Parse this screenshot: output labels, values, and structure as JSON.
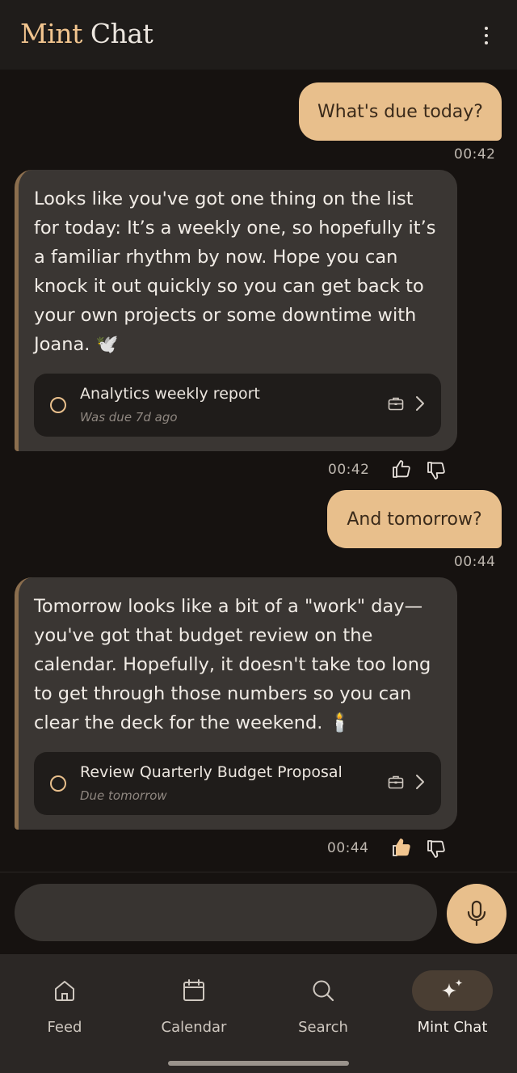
{
  "header": {
    "title_part1": "Mint",
    "title_part2": " Chat",
    "menu_icon": "more-vertical-icon"
  },
  "messages": [
    {
      "role": "user",
      "text": "What's due today?",
      "time": "00:42"
    },
    {
      "role": "assistant",
      "text": "Looks like you've got one thing on the list for today: It’s a weekly one, so hopefully it’s a familiar rhythm by now. Hope you can knock it out quickly so you can get back to your own projects or some downtime with Joana. 🕊️",
      "task": {
        "title": "Analytics weekly report",
        "subtitle": "Was due 7d ago"
      },
      "time": "00:42",
      "thumbs_up": false
    },
    {
      "role": "user",
      "text": "And tomorrow?",
      "time": "00:44"
    },
    {
      "role": "assistant",
      "text": "Tomorrow looks like a bit of a \"work\" day—you've got that budget review on the calendar. Hopefully, it doesn't take too long to get through those numbers so you can clear the deck for the weekend. 🕯️",
      "task": {
        "title": "Review Quarterly Budget Proposal",
        "subtitle": "Due tomorrow"
      },
      "time": "00:44",
      "thumbs_up": true
    }
  ],
  "composer": {
    "value": "",
    "mic_icon": "microphone-icon"
  },
  "nav": {
    "items": [
      {
        "label": "Feed",
        "icon": "home-icon",
        "active": false
      },
      {
        "label": "Calendar",
        "icon": "calendar-icon",
        "active": false
      },
      {
        "label": "Search",
        "icon": "search-icon",
        "active": false
      },
      {
        "label": "Mint Chat",
        "icon": "sparkles-icon",
        "active": true
      }
    ]
  },
  "colors": {
    "accent": "#e8bf8c",
    "background": "#161210",
    "bubble_bot": "#3a3633",
    "card": "#1f1c1a",
    "nav": "#2b2725"
  }
}
